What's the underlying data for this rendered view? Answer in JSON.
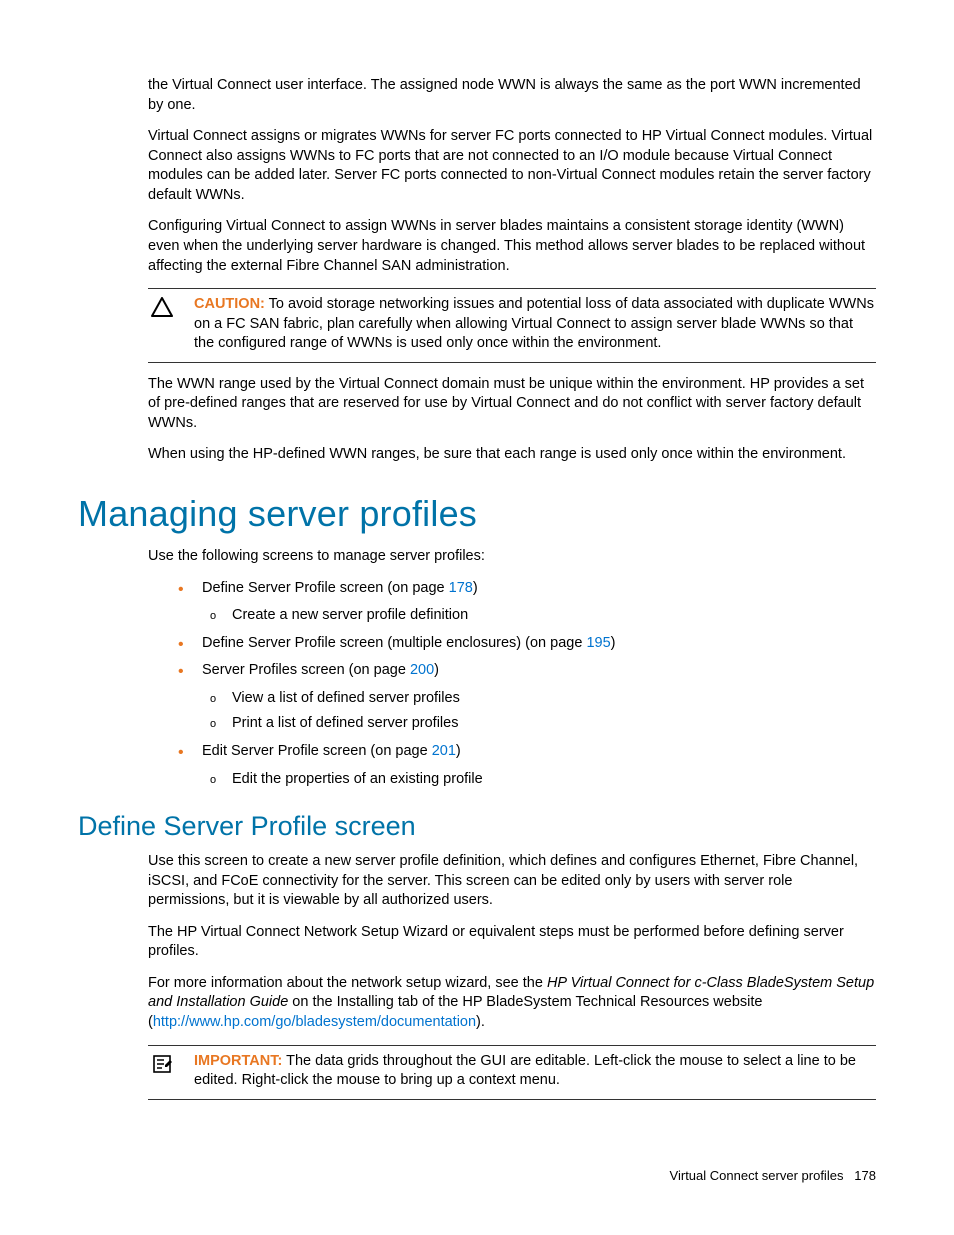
{
  "para1": "the Virtual Connect user interface. The assigned node WWN is always the same as the port WWN incremented by one.",
  "para2": "Virtual Connect assigns or migrates WWNs for server FC ports connected to HP Virtual Connect modules. Virtual Connect also assigns WWNs to FC ports that are not connected to an I/O module because Virtual Connect modules can be added later. Server FC ports connected to non-Virtual Connect modules retain the server factory default WWNs.",
  "para3": "Configuring Virtual Connect to assign WWNs in server blades maintains a consistent storage identity (WWN) even when the underlying server hardware is changed. This method allows server blades to be replaced without affecting the external Fibre Channel SAN administration.",
  "caution": {
    "label": "CAUTION:",
    "text": " To avoid storage networking issues and potential loss of data associated with duplicate WWNs on a FC SAN fabric, plan carefully when allowing Virtual Connect to assign server blade WWNs so that the configured range of WWNs is used only once within the environment."
  },
  "para4": "The WWN range used by the Virtual Connect domain must be unique within the environment. HP provides a set of pre-defined ranges that are reserved for use by Virtual Connect and do not conflict with server factory default WWNs.",
  "para5": "When using the HP-defined WWN ranges, be sure that each range is used only once within the environment.",
  "h1": "Managing server profiles",
  "intro": "Use the following screens to manage server profiles:",
  "bullets": [
    {
      "pre": "Define Server Profile screen (on page ",
      "link": "178",
      "post": ")",
      "sub": [
        "Create a new server profile definition"
      ]
    },
    {
      "pre": "Define Server Profile screen (multiple enclosures) (on page ",
      "link": "195",
      "post": ")"
    },
    {
      "pre": "Server Profiles screen (on page ",
      "link": "200",
      "post": ")",
      "sub": [
        "View a list of defined server profiles",
        "Print a list of defined server profiles"
      ]
    },
    {
      "pre": "Edit Server Profile screen (on page ",
      "link": "201",
      "post": ")",
      "sub": [
        "Edit the properties of an existing profile"
      ]
    }
  ],
  "h2": "Define Server Profile screen",
  "def1": "Use this screen to create a new server profile definition, which defines and configures Ethernet, Fibre Channel, iSCSI, and FCoE connectivity for the server. This screen can be edited only by users with server role permissions, but it is viewable by all authorized users.",
  "def2": "The HP Virtual Connect Network Setup Wizard or equivalent steps must be performed before defining server profiles.",
  "def3a": "For more information about the network setup wizard, see the ",
  "def3italic": "HP Virtual Connect for c-Class BladeSystem Setup and Installation Guide",
  "def3b": " on the Installing tab of the HP BladeSystem Technical Resources website (",
  "def3link": "http://www.hp.com/go/bladesystem/documentation",
  "def3c": ").",
  "important": {
    "label": "IMPORTANT:",
    "text": " The data grids throughout the GUI are editable. Left-click the mouse to select a line to be edited. Right-click the mouse to bring up a context menu."
  },
  "footer": {
    "text": "Virtual Connect server profiles",
    "page": "178"
  }
}
